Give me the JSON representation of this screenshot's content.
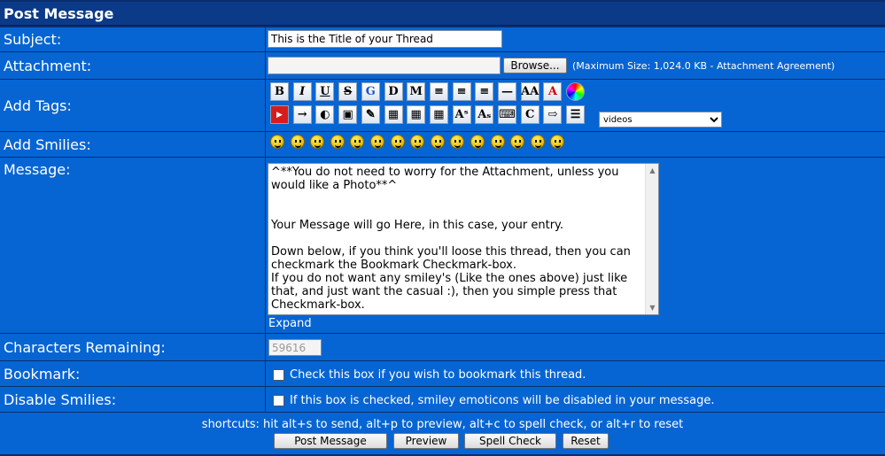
{
  "header": {
    "title": "Post Message"
  },
  "subject": {
    "label": "Subject:",
    "value": "This is the Title of your Thread"
  },
  "attachment": {
    "label": "Attachment:",
    "browse_label": "Browse...",
    "note": "(Maximum Size: 1,024.0 KB - Attachment Agreement)"
  },
  "tags": {
    "label": "Add Tags:",
    "row1": [
      {
        "name": "bold-icon",
        "glyph": "B"
      },
      {
        "name": "italic-icon",
        "glyph": "I"
      },
      {
        "name": "underline-icon",
        "glyph": "U"
      },
      {
        "name": "strikethrough-icon",
        "glyph": "S"
      },
      {
        "name": "google-icon",
        "glyph": "G"
      },
      {
        "name": "define-icon",
        "glyph": "D"
      },
      {
        "name": "mention-icon",
        "glyph": "M"
      },
      {
        "name": "align-left-icon",
        "glyph": "≡"
      },
      {
        "name": "align-center-icon",
        "glyph": "≡"
      },
      {
        "name": "align-right-icon",
        "glyph": "≡"
      },
      {
        "name": "horizontal-rule-icon",
        "glyph": "—"
      },
      {
        "name": "font-size-icon",
        "glyph": "AA"
      },
      {
        "name": "font-color-icon",
        "glyph": "A"
      },
      {
        "name": "color-wheel-icon",
        "glyph": "●"
      }
    ],
    "row2": [
      {
        "name": "youtube-icon",
        "glyph": "▶"
      },
      {
        "name": "arrow-icon",
        "glyph": "→"
      },
      {
        "name": "globe-icon",
        "glyph": "◐"
      },
      {
        "name": "image-icon",
        "glyph": "▣"
      },
      {
        "name": "link-icon",
        "glyph": "✎"
      },
      {
        "name": "table-icon",
        "glyph": "▦"
      },
      {
        "name": "table-row-icon",
        "glyph": "▦"
      },
      {
        "name": "table-column-icon",
        "glyph": "▦"
      },
      {
        "name": "superscript-icon",
        "glyph": "Aˢ"
      },
      {
        "name": "subscript-icon",
        "glyph": "Aₛ"
      },
      {
        "name": "spoiler-icon",
        "glyph": "⌨"
      },
      {
        "name": "code-icon",
        "glyph": "C"
      },
      {
        "name": "quote-icon",
        "glyph": "⇨"
      },
      {
        "name": "list-icon",
        "glyph": "☰"
      }
    ],
    "dropdown_value": "videos"
  },
  "smilies": {
    "label": "Add Smilies:",
    "count": 15
  },
  "message": {
    "label": "Message:",
    "text": "^**You do not need to worry for the Attachment, unless you would like a Photo**^\n\n\nYour Message will go Here, in this case, your entry.\n\nDown below, if you think you'll loose this thread, then you can checkmark the Bookmark Checkmark-box.\nIf you do not want any smiley's (Like the ones above) just like that, and just want the casual :), then you simple press that Checkmark-box.",
    "expand_label": "Expand"
  },
  "chars": {
    "label": "Characters Remaining:",
    "value": "59616"
  },
  "bookmark": {
    "label": "Bookmark:",
    "text": "Check this box if you wish to bookmark this thread."
  },
  "disable_smilies": {
    "label": "Disable Smilies:",
    "text": "If this box is checked, smiley emoticons will be disabled in your message."
  },
  "footer": {
    "shortcuts": "shortcuts: hit alt+s to send, alt+p to preview, alt+c to spell check, or alt+r to reset",
    "buttons": [
      "Post Message",
      "Preview",
      "Spell Check",
      "Reset"
    ]
  }
}
